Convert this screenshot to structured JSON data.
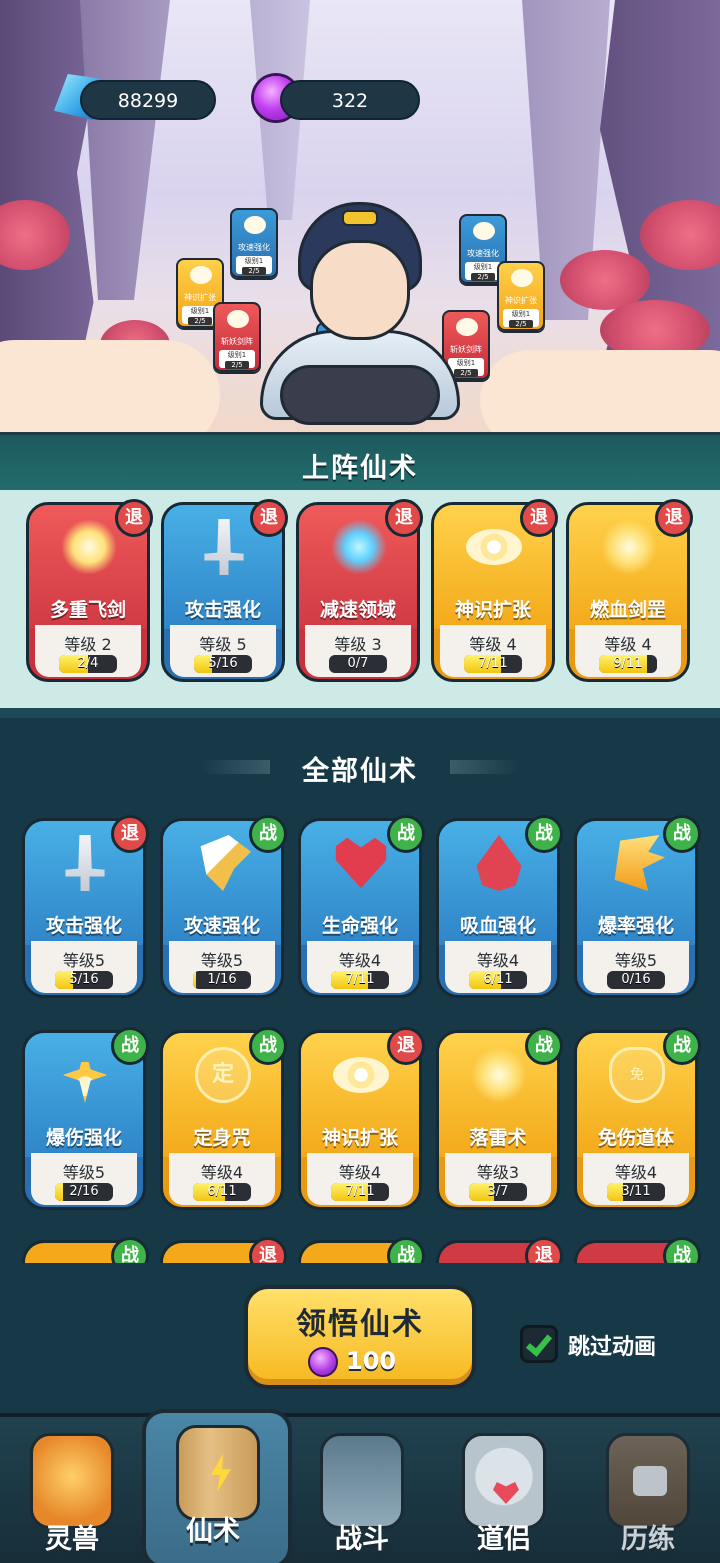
{
  "resources": {
    "crystal": "88299",
    "gem": "322"
  },
  "scene_cards": [
    {
      "label": "攻速强化",
      "level": "级别1",
      "progress": "2/5",
      "color": "blue"
    },
    {
      "label": "神识扩张",
      "level": "级别1",
      "progress": "2/5",
      "color": "yellow"
    },
    {
      "label": "斩妖剑阵",
      "level": "级别1",
      "progress": "2/5",
      "color": "red"
    },
    {
      "label": "攻速强化",
      "level": "级别1",
      "progress": "2/5",
      "color": "blue"
    },
    {
      "label": "攻速强化",
      "level": "级别1",
      "progress": "2/5",
      "color": "blue"
    },
    {
      "label": "神识扩张",
      "level": "级别1",
      "progress": "2/5",
      "color": "yellow"
    },
    {
      "label": "斩妖剑阵",
      "level": "级别1",
      "progress": "2/5",
      "color": "red"
    }
  ],
  "equipped": {
    "title": "上阵仙术",
    "cards": [
      {
        "name": "多重飞剑",
        "level": "等级 2",
        "progress": "2/4",
        "fill": 0.5,
        "color": "red",
        "badge": "退",
        "icon": "flying-swords-icon"
      },
      {
        "name": "攻击强化",
        "level": "等级 5",
        "progress": "5/16",
        "fill": 0.31,
        "color": "blue",
        "badge": "退",
        "icon": "sword-icon"
      },
      {
        "name": "减速领域",
        "level": "等级 3",
        "progress": "0/7",
        "fill": 0,
        "color": "red",
        "badge": "退",
        "icon": "slow-field-icon"
      },
      {
        "name": "神识扩张",
        "level": "等级 4",
        "progress": "7/11",
        "fill": 0.64,
        "color": "yellow",
        "badge": "退",
        "icon": "eye-icon"
      },
      {
        "name": "燃血剑罡",
        "level": "等级 4",
        "progress": "9/11",
        "fill": 0.82,
        "color": "yellow",
        "badge": "退",
        "icon": "blood-sword-icon"
      }
    ]
  },
  "all": {
    "title": "全部仙术",
    "cards": [
      {
        "name": "攻击强化",
        "level": "等级5",
        "progress": "5/16",
        "fill": 0.31,
        "color": "blue",
        "badge": "退",
        "icon": "sword-icon"
      },
      {
        "name": "攻速强化",
        "level": "等级5",
        "progress": "1/16",
        "fill": 0.06,
        "color": "blue",
        "badge": "战",
        "icon": "wings-icon"
      },
      {
        "name": "生命强化",
        "level": "等级4",
        "progress": "7/11",
        "fill": 0.64,
        "color": "blue",
        "badge": "战",
        "icon": "heart-icon"
      },
      {
        "name": "吸血强化",
        "level": "等级4",
        "progress": "6/11",
        "fill": 0.55,
        "color": "blue",
        "badge": "战",
        "icon": "blood-drop-icon"
      },
      {
        "name": "爆率强化",
        "level": "等级5",
        "progress": "0/16",
        "fill": 0,
        "color": "blue",
        "badge": "战",
        "icon": "claw-icon"
      },
      {
        "name": "爆伤强化",
        "level": "等级5",
        "progress": "2/16",
        "fill": 0.13,
        "color": "blue",
        "badge": "战",
        "icon": "burst-icon"
      },
      {
        "name": "定身咒",
        "level": "等级4",
        "progress": "6/11",
        "fill": 0.55,
        "color": "yellow",
        "badge": "战",
        "icon": "seal-icon"
      },
      {
        "name": "神识扩张",
        "level": "等级4",
        "progress": "7/11",
        "fill": 0.64,
        "color": "yellow",
        "badge": "退",
        "icon": "eye-icon"
      },
      {
        "name": "落雷术",
        "level": "等级3",
        "progress": "3/7",
        "fill": 0.43,
        "color": "yellow",
        "badge": "战",
        "icon": "lightning-icon"
      },
      {
        "name": "免伤道体",
        "level": "等级4",
        "progress": "3/11",
        "fill": 0.27,
        "color": "yellow",
        "badge": "战",
        "icon": "shield-icon"
      }
    ],
    "peek": [
      {
        "color": "yellow",
        "badge": "战"
      },
      {
        "color": "yellow",
        "badge": "退"
      },
      {
        "color": "yellow",
        "badge": "战"
      },
      {
        "color": "red",
        "badge": "退"
      },
      {
        "color": "red",
        "badge": "战"
      }
    ]
  },
  "learn": {
    "label": "领悟仙术",
    "cost": "100"
  },
  "skip_animation": {
    "label": "跳过动画",
    "checked": true
  },
  "nav": [
    {
      "label": "灵兽",
      "icon": "egg-icon",
      "active": false
    },
    {
      "label": "仙术",
      "icon": "scroll-bolt-icon",
      "active": true
    },
    {
      "label": "战斗",
      "icon": "gate-icon",
      "active": false
    },
    {
      "label": "道侣",
      "icon": "companion-icon",
      "active": false
    },
    {
      "label": "历练",
      "icon": "locked-scroll-icon",
      "active": false
    }
  ],
  "colors": {
    "red": "#c8323c",
    "blue": "#2a6fb0",
    "yellow": "#e89a12",
    "quit_badge": "#e24a4a",
    "fight_badge": "#3fb24a",
    "bar_fill": "#f2c512"
  }
}
